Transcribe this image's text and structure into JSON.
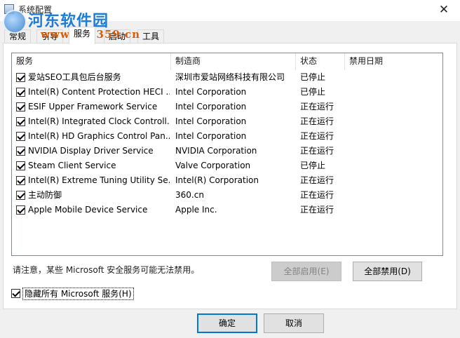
{
  "window": {
    "title": "系统配置",
    "close_glyph": "✕"
  },
  "watermark": {
    "text_cn": "河东软件园",
    "url": "www.pc0359.cn"
  },
  "tabs": [
    {
      "label": "常规",
      "active": false
    },
    {
      "label": "引导",
      "active": false
    },
    {
      "label": "服务",
      "active": true
    },
    {
      "label": "启动",
      "active": false
    },
    {
      "label": "工具",
      "active": false
    }
  ],
  "list": {
    "columns": [
      "服务",
      "制造商",
      "状态",
      "禁用日期"
    ],
    "rows": [
      {
        "checked": true,
        "service": "爱站SEO工具包后台服务",
        "vendor": "深圳市爱站网络科技有限公司",
        "status": "已停止",
        "date": ""
      },
      {
        "checked": true,
        "service": "Intel(R) Content Protection HECI ...",
        "vendor": "Intel Corporation",
        "status": "已停止",
        "date": ""
      },
      {
        "checked": true,
        "service": "ESIF Upper Framework Service",
        "vendor": "Intel Corporation",
        "status": "正在运行",
        "date": ""
      },
      {
        "checked": true,
        "service": "Intel(R) Integrated Clock Controll...",
        "vendor": "Intel Corporation",
        "status": "正在运行",
        "date": ""
      },
      {
        "checked": true,
        "service": "Intel(R) HD Graphics Control Pan...",
        "vendor": "Intel Corporation",
        "status": "正在运行",
        "date": ""
      },
      {
        "checked": true,
        "service": "NVIDIA Display Driver Service",
        "vendor": "NVIDIA Corporation",
        "status": "正在运行",
        "date": ""
      },
      {
        "checked": true,
        "service": "Steam Client Service",
        "vendor": "Valve Corporation",
        "status": "已停止",
        "date": ""
      },
      {
        "checked": true,
        "service": "Intel(R) Extreme Tuning Utility Se...",
        "vendor": "Intel(R) Corporation",
        "status": "正在运行",
        "date": ""
      },
      {
        "checked": true,
        "service": "主动防御",
        "vendor": "360.cn",
        "status": "正在运行",
        "date": ""
      },
      {
        "checked": true,
        "service": "Apple Mobile Device Service",
        "vendor": "Apple Inc.",
        "status": "正在运行",
        "date": ""
      }
    ]
  },
  "note": "请注意，某些 Microsoft 安全服务可能无法禁用。",
  "buttons": {
    "enable_all": "全部启用(E)",
    "disable_all": "全部禁用(D)",
    "ok": "确定",
    "cancel": "取消"
  },
  "hide_ms": {
    "checked": true,
    "label": "隐藏所有 Microsoft 服务(H)"
  }
}
